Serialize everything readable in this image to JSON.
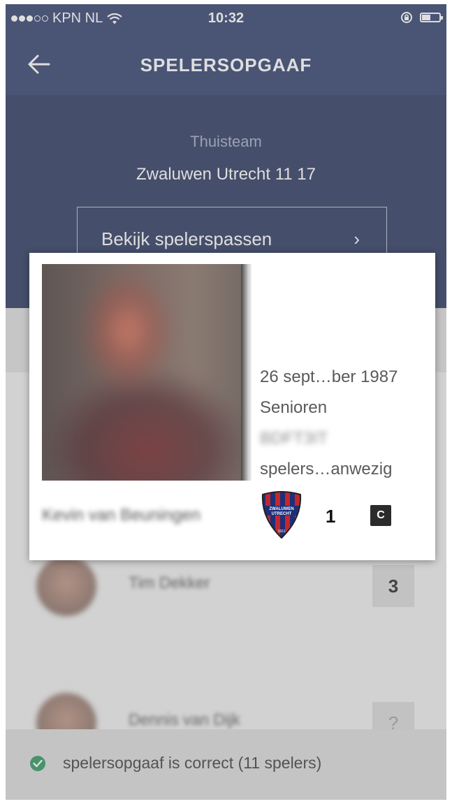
{
  "status_bar": {
    "carrier": "KPN NL",
    "time": "10:32"
  },
  "nav": {
    "title": "SPELERSOPGAAF",
    "back_icon": "arrow-left-icon"
  },
  "team": {
    "label": "Thuisteam",
    "name": "Zwaluwen Utrecht 11 17",
    "passes_button": "Bekijk spelerspassen",
    "passes_chevron": "›"
  },
  "players": [
    {
      "name": "Tim Dekker",
      "number": "3"
    },
    {
      "name": "Dennis van Dijk",
      "number": "?"
    }
  ],
  "player_card": {
    "birthdate": "26 sept…ber 1987",
    "category": "Senioren",
    "code": "BDFT3IT",
    "status": "spelers…anwezig",
    "name": "Kevin van Beuningen",
    "shirt_number": "1",
    "captain_badge": "C",
    "club_logo_text": "ZWALUWEN UTRECHT",
    "club_logo_year": "1911"
  },
  "footer": {
    "status_text": "spelersopgaaf is correct (11 spelers)"
  },
  "colors": {
    "navy": "#1d2b5e",
    "navy_dark": "#15224e",
    "success": "#1a8c4e"
  }
}
